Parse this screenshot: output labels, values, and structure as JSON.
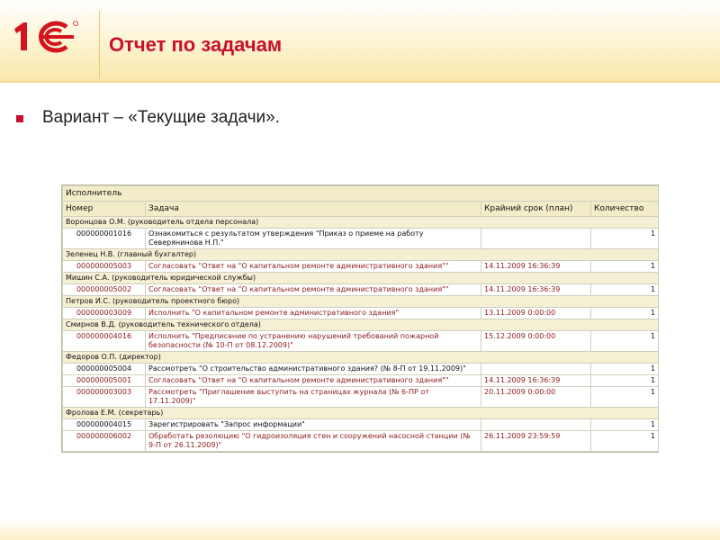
{
  "slide": {
    "title": "Отчет по задачам",
    "bullet": "Вариант – «Текущие задачи»."
  },
  "colors": {
    "accent": "#c8102e",
    "header_bg": "#f3ecc8",
    "group_bg": "#f5efd3"
  },
  "report": {
    "group_header": "Исполнитель",
    "columns": [
      "Номер",
      "Задача",
      "Крайний срок (план)",
      "Количество"
    ],
    "groups": [
      {
        "name": "Воронцова О.М. (руководитель отдела персонала)",
        "rows": [
          {
            "num": "000000001016",
            "task": "Ознакомиться с результатом утверждения \"Приказ о приеме на работу Северянинова Н.П.\"",
            "deadline": "",
            "qty": "1",
            "red": false
          }
        ]
      },
      {
        "name": "Зеленец Н.В. (главный бухгалтер)",
        "rows": [
          {
            "num": "000000005003",
            "task": "Согласовать \"Ответ на \"О капитальном ремонте административного здания\"\"",
            "deadline": "14.11.2009 16:36:39",
            "qty": "1",
            "red": true
          }
        ]
      },
      {
        "name": "Мишин С.А. (руководитель юридической службы)",
        "rows": [
          {
            "num": "000000005002",
            "task": "Согласовать \"Ответ на \"О капитальном ремонте административного здания\"\"",
            "deadline": "14.11.2009 16:36:39",
            "qty": "1",
            "red": true
          }
        ]
      },
      {
        "name": "Петров И.С. (руководитель проектного бюро)",
        "rows": [
          {
            "num": "000000003009",
            "task": "Исполнить \"О капитальном ремонте административного здания\"",
            "deadline": "13.11.2009 0:00:00",
            "qty": "1",
            "red": true
          }
        ]
      },
      {
        "name": "Смирнов В.Д. (руководитель технического отдела)",
        "rows": [
          {
            "num": "000000004016",
            "task": "Исполнить \"Предписание по устранению нарушений требований пожарной безопасности (№ 10-П от 08.12.2009)\"",
            "deadline": "15.12.2009 0:00:00",
            "qty": "1",
            "red": true
          }
        ]
      },
      {
        "name": "Федоров О.П. (директор)",
        "rows": [
          {
            "num": "000000005004",
            "task": "Рассмотреть \"О строительство административного здания? (№ 8-П от 19.11.2009)\"",
            "deadline": "",
            "qty": "1",
            "red": false
          },
          {
            "num": "000000005001",
            "task": "Согласовать \"Ответ на \"О капитальном ремонте административного здания\"\"",
            "deadline": "14.11.2009 16:36:39",
            "qty": "1",
            "red": true
          },
          {
            "num": "000000003003",
            "task": "Рассмотреть \"Приглашение выступить на страницах журнала (№ 6-ПР от 17.11.2009)\"",
            "deadline": "20.11.2009 0:00:00",
            "qty": "1",
            "red": true
          }
        ]
      },
      {
        "name": "Фролова Е.М. (секретарь)",
        "rows": [
          {
            "num": "000000004015",
            "task": "Зарегистрировать \"Запрос информации\"",
            "deadline": "",
            "qty": "1",
            "red": false
          },
          {
            "num": "000000006002",
            "task": "Обработать резолюцию \"О гидроизоляция стен и сооружений насосной станции (№ 9-П от 26.11.2009)\"",
            "deadline": "26.11.2009 23:59:59",
            "qty": "1",
            "red": true
          }
        ]
      }
    ]
  }
}
